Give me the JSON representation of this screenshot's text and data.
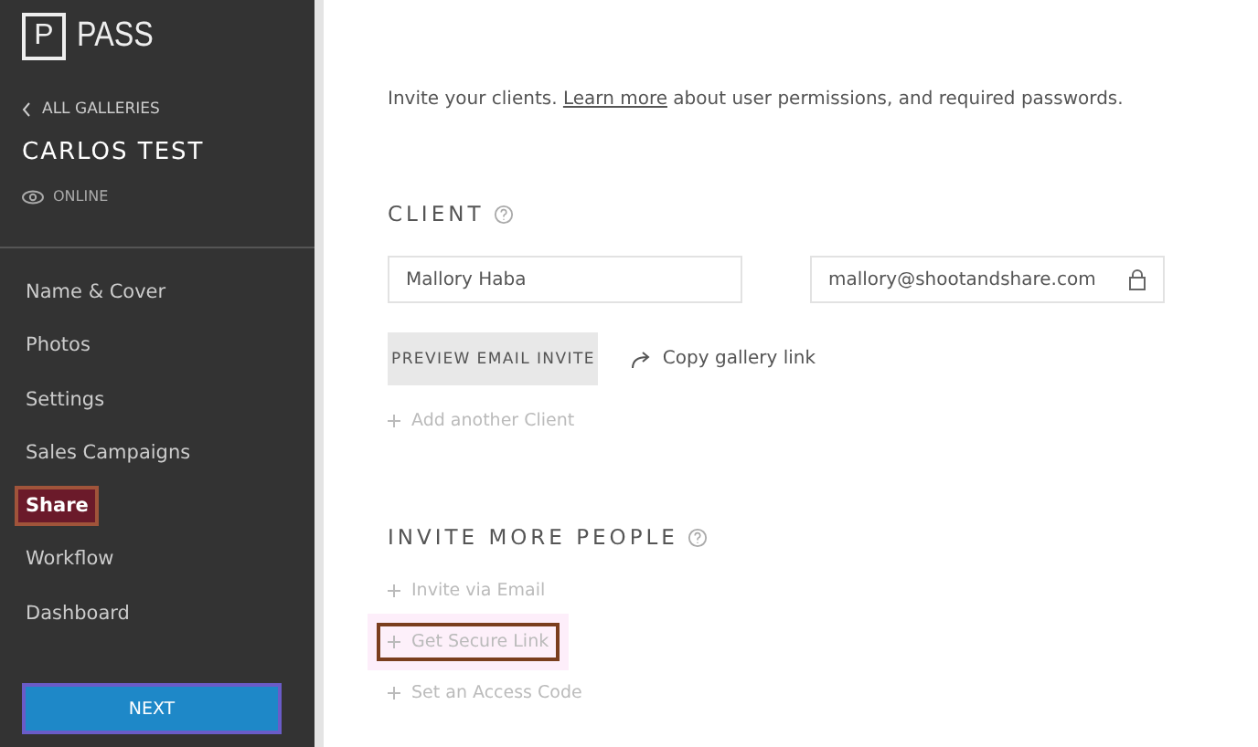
{
  "logo": {
    "letter": "P",
    "name": "PASS"
  },
  "back_link": "ALL GALLERIES",
  "gallery_title": "CARLOS TEST",
  "status": "ONLINE",
  "nav": [
    {
      "label": "Name & Cover",
      "selected": false
    },
    {
      "label": "Photos",
      "selected": false
    },
    {
      "label": "Settings",
      "selected": false
    },
    {
      "label": "Sales Campaigns",
      "selected": false
    },
    {
      "label": "Share",
      "selected": true
    },
    {
      "label": "Workflow",
      "selected": false
    },
    {
      "label": "Dashboard",
      "selected": false
    }
  ],
  "next_button": "NEXT",
  "intro": {
    "before": "Invite your clients.",
    "link": "Learn more",
    "after": "about user permissions, and required passwords."
  },
  "client_section": {
    "title": "CLIENT",
    "name_value": "Mallory Haba",
    "email_value": "mallory@shootandshare.com",
    "preview_button": "PREVIEW EMAIL INVITE",
    "copy_link": "Copy gallery link",
    "add_link": "Add another Client"
  },
  "invite_section": {
    "title": "INVITE MORE PEOPLE",
    "options": [
      {
        "label": "Invite via Email",
        "highlighted": false
      },
      {
        "label": "Get Secure Link",
        "highlighted": true
      },
      {
        "label": "Set an Access Code",
        "highlighted": false
      }
    ]
  }
}
